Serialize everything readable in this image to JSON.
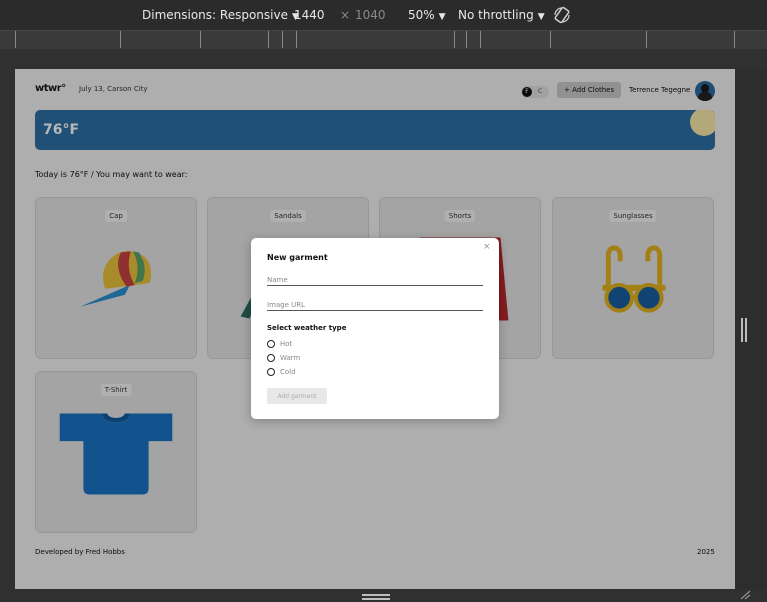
{
  "devtools": {
    "dimensions_label": "Dimensions: Responsive",
    "width": "1440",
    "times": "×",
    "height": "1040",
    "zoom": "50%",
    "throttling": "No throttling"
  },
  "app": {
    "logo": "wtwr°",
    "date_location": "July 13, Carson City",
    "toggle_on": "F",
    "toggle_off": "C",
    "add_button": "+ Add Clothes",
    "username": "Terrence Tegegne",
    "temperature": "76°F",
    "headline": "Today is 76°F / You may want to wear:",
    "cards": [
      {
        "name": "Cap"
      },
      {
        "name": "Sandals"
      },
      {
        "name": "Shorts"
      },
      {
        "name": "Sunglasses"
      },
      {
        "name": "T-Shirt"
      }
    ],
    "footer_left": "Developed by Fred Hobbs",
    "footer_right": "2025"
  },
  "modal": {
    "title": "New garment",
    "close": "×",
    "name_placeholder": "Name",
    "image_placeholder": "Image URL",
    "weather_label": "Select weather type",
    "options": [
      "Hot",
      "Warm",
      "Cold"
    ],
    "submit": "Add garment"
  },
  "colors": {
    "banner": "#2d6fa4",
    "sun": "#f7e9a8",
    "shirt": "#1a74c4"
  }
}
